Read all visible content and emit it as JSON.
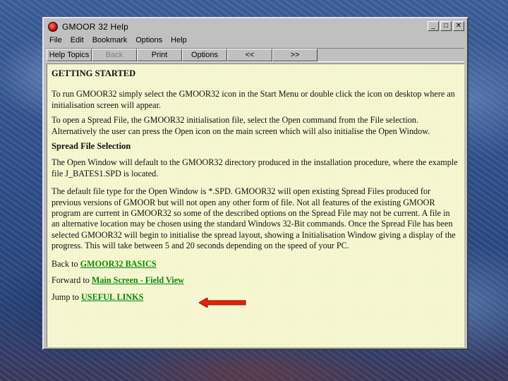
{
  "window": {
    "title": "GMOOR 32 Help",
    "buttons": {
      "minimize": "_",
      "maximize": "□",
      "close": "✕"
    }
  },
  "menu": [
    "File",
    "Edit",
    "Bookmark",
    "Options",
    "Help"
  ],
  "toolbar": {
    "help_topics": "Help Topics",
    "back": "Back",
    "print": "Print",
    "options": "Options",
    "prev": "<<",
    "next": ">>"
  },
  "content": {
    "heading1": "GETTING STARTED",
    "para1": "To run GMOOR32 simply select the GMOOR32 icon in the Start Menu or double click the icon on desktop where an initialisation screen will appear.",
    "para2": "To open a Spread File, the GMOOR32 initialisation file, select the Open command from the File selection. Alternatively the user can press the Open icon on the main screen which will also initialise the Open Window.",
    "heading2": "Spread File Selection",
    "para3": "The Open Window will default to the GMOOR32 directory produced in the installation procedure, where the example file J_BATES1.SPD is located.",
    "para4": "The default file type for the Open Window is *.SPD. GMOOR32 will open existing Spread Files produced for previous versions of GMOOR but will not open any other form of file. Not all features of the existing GMOOR program are current in GMOOR32 so some of the described options on the Spread File may not be current. A file in an alternative location may be chosen using the standard Windows 32-Bit commands. Once the Spread File has been selected GMOOR32 will begin to initialise the spread layout, showing a Initialisation Window giving a display of the progress. This will take between 5 and 20 seconds depending on the speed of your PC.",
    "back_prefix": "Back to ",
    "back_link": "GMOOR32 BASICS",
    "forward_prefix": "Forward to ",
    "forward_link": "Main Screen - Field View",
    "jump_prefix": "Jump to ",
    "jump_link": "USEFUL LINKS"
  },
  "colors": {
    "link": "#0a8a0a",
    "arrow": "#e8200c",
    "content_bg": "#fbfbd8"
  }
}
